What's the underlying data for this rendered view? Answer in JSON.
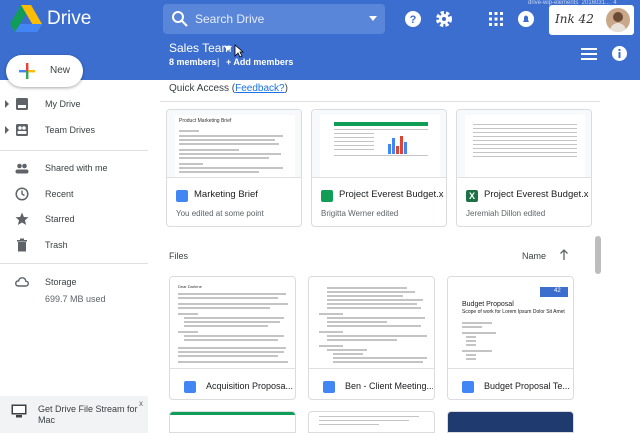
{
  "header": {
    "brand": "Drive",
    "search_placeholder": "Search Drive",
    "account_logo": "Ink 42",
    "watermark": "drive-wip-elements_2016031..._4",
    "team": {
      "name": "Sales Team",
      "members": "8 members",
      "separator": "|",
      "add_members": "+ Add members"
    },
    "icons": [
      "help-icon",
      "settings-icon",
      "apps-icon",
      "notifications-icon",
      "list-view-icon",
      "info-icon"
    ]
  },
  "sidebar": {
    "new_label": "New",
    "items": [
      {
        "label": "My Drive",
        "icon": "my-drive-icon"
      },
      {
        "label": "Team Drives",
        "icon": "team-drives-icon"
      },
      {
        "label": "Shared with me",
        "icon": "people-icon"
      },
      {
        "label": "Recent",
        "icon": "clock-icon"
      },
      {
        "label": "Starred",
        "icon": "star-icon"
      },
      {
        "label": "Trash",
        "icon": "trash-icon"
      },
      {
        "label": "Storage",
        "icon": "cloud-icon"
      }
    ],
    "storage_used": "699.7 MB used",
    "banner": {
      "text": "Get Drive File Stream for Mac",
      "close": "x"
    }
  },
  "quick_access": {
    "title": "Quick Access (",
    "link": "Feedback?",
    "title_end": ")",
    "cards": [
      {
        "name": "Marketing Brief",
        "sub": "You edited at some point",
        "type": "doc",
        "thumb_title": "Product Marketing Brief"
      },
      {
        "name": "Project Everest Budget.xl...",
        "sub": "Brigitta Werner edited",
        "type": "sheet"
      },
      {
        "name": "Project Everest Budget.xl...",
        "sub": "Jeremiah Dillon edited",
        "type": "excel",
        "type_glyph": "X"
      }
    ]
  },
  "files": {
    "title": "Files",
    "sort_label": "Name",
    "items": [
      {
        "name": "Acquisition Proposa...",
        "thumb_heading": "Dear Darlene"
      },
      {
        "name": "Ben - Client Meeting..."
      },
      {
        "name": "Budget Proposal Te...",
        "thumb_title": "Budget Proposal",
        "thumb_subtitle": "Scope of work for Lorem Ipsum Dolor Sit Amet",
        "thumb_badge": "42"
      }
    ]
  },
  "colors": {
    "header_bg": "#3c6ecf",
    "accent_blue": "#1a73e8",
    "doc_blue": "#4285f4",
    "sheet_green": "#0f9d58",
    "excel_green": "#1e7145"
  }
}
